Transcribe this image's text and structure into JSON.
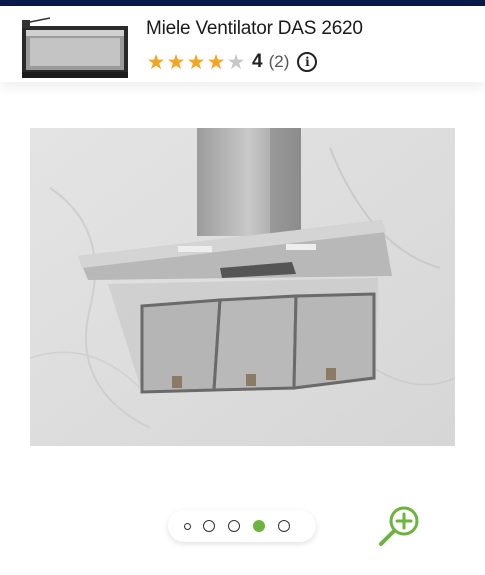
{
  "header": {
    "title": "Miele Ventilator DAS 2620",
    "rating": {
      "stars": 4,
      "max_stars": 5,
      "score_label": "4",
      "count_label": "(2)"
    },
    "info_icon": "info-icon"
  },
  "gallery": {
    "current_slide": 4,
    "slide_count": 5,
    "zoom_icon": "zoom-in-icon"
  },
  "colors": {
    "top_bar": "#0a1a44",
    "star": "#f2a623",
    "active_dot": "#6db33f",
    "zoom_icon": "#6db33f"
  }
}
